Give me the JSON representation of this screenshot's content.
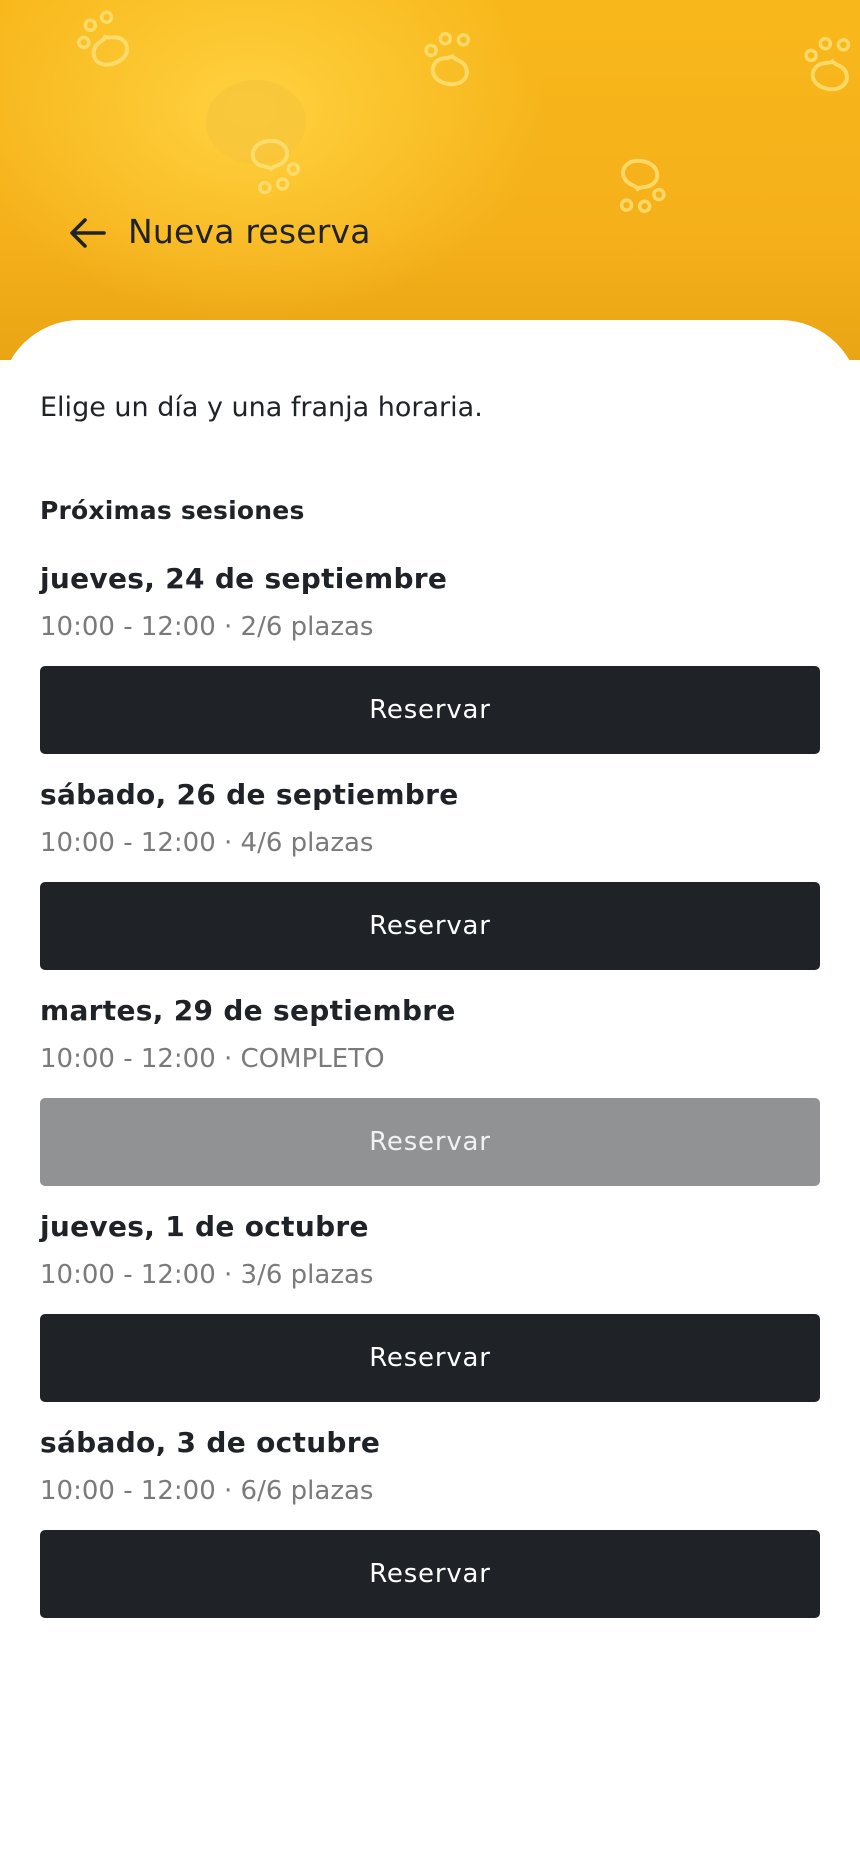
{
  "header": {
    "title": "Nueva reserva"
  },
  "intro": "Elige un día y una franja horaria.",
  "section_title": "Próximas sesiones",
  "sessions": [
    {
      "date": "jueves, 24 de septiembre",
      "info": "10:00 - 12:00 · 2/6 plazas",
      "button": "Reservar",
      "enabled": true
    },
    {
      "date": "sábado, 26 de septiembre",
      "info": "10:00 - 12:00 · 4/6 plazas",
      "button": "Reservar",
      "enabled": true
    },
    {
      "date": "martes, 29 de septiembre",
      "info": "10:00 - 12:00 · COMPLETO",
      "button": "Reservar",
      "enabled": false
    },
    {
      "date": "jueves, 1 de octubre",
      "info": "10:00 - 12:00 · 3/6 plazas",
      "button": "Reservar",
      "enabled": true
    },
    {
      "date": "sábado, 3 de octubre",
      "info": "10:00 - 12:00 · 6/6 plazas",
      "button": "Reservar",
      "enabled": true
    }
  ],
  "icons": {
    "back": "arrow-left-icon",
    "decoration": "paw-icon"
  },
  "colors": {
    "header": "#f6b31b",
    "button": "#1f2328",
    "button_disabled": "#919293",
    "muted_text": "#7a7a7a"
  }
}
